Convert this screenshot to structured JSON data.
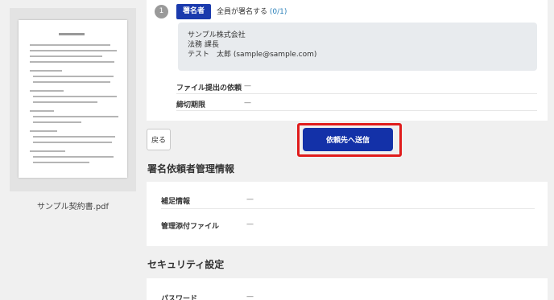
{
  "document": {
    "filename": "サンプル契約書.pdf"
  },
  "signer": {
    "step_number": "1",
    "role_badge": "署名者",
    "status_text": "全員が署名する",
    "status_count": "(0/1)",
    "company": "サンプル株式会社",
    "department": "法務 課長",
    "name_email": "テスト　太郎 (sample@sample.com)",
    "rows": [
      {
        "label": "ファイル提出の依頼",
        "value": "—"
      },
      {
        "label": "締切期限",
        "value": "—"
      }
    ]
  },
  "actions": {
    "back_label": "戻る",
    "send_label": "依頼先へ送信",
    "highlight_color": "#e01c1c",
    "primary_color": "#1331a8"
  },
  "management": {
    "title": "署名依頼者管理情報",
    "rows": [
      {
        "label": "補足情報",
        "value": "—"
      },
      {
        "label": "管理添付ファイル",
        "value": "—"
      }
    ]
  },
  "security": {
    "title": "セキュリティ設定",
    "rows": [
      {
        "label": "パスワード",
        "value": "—"
      }
    ]
  }
}
